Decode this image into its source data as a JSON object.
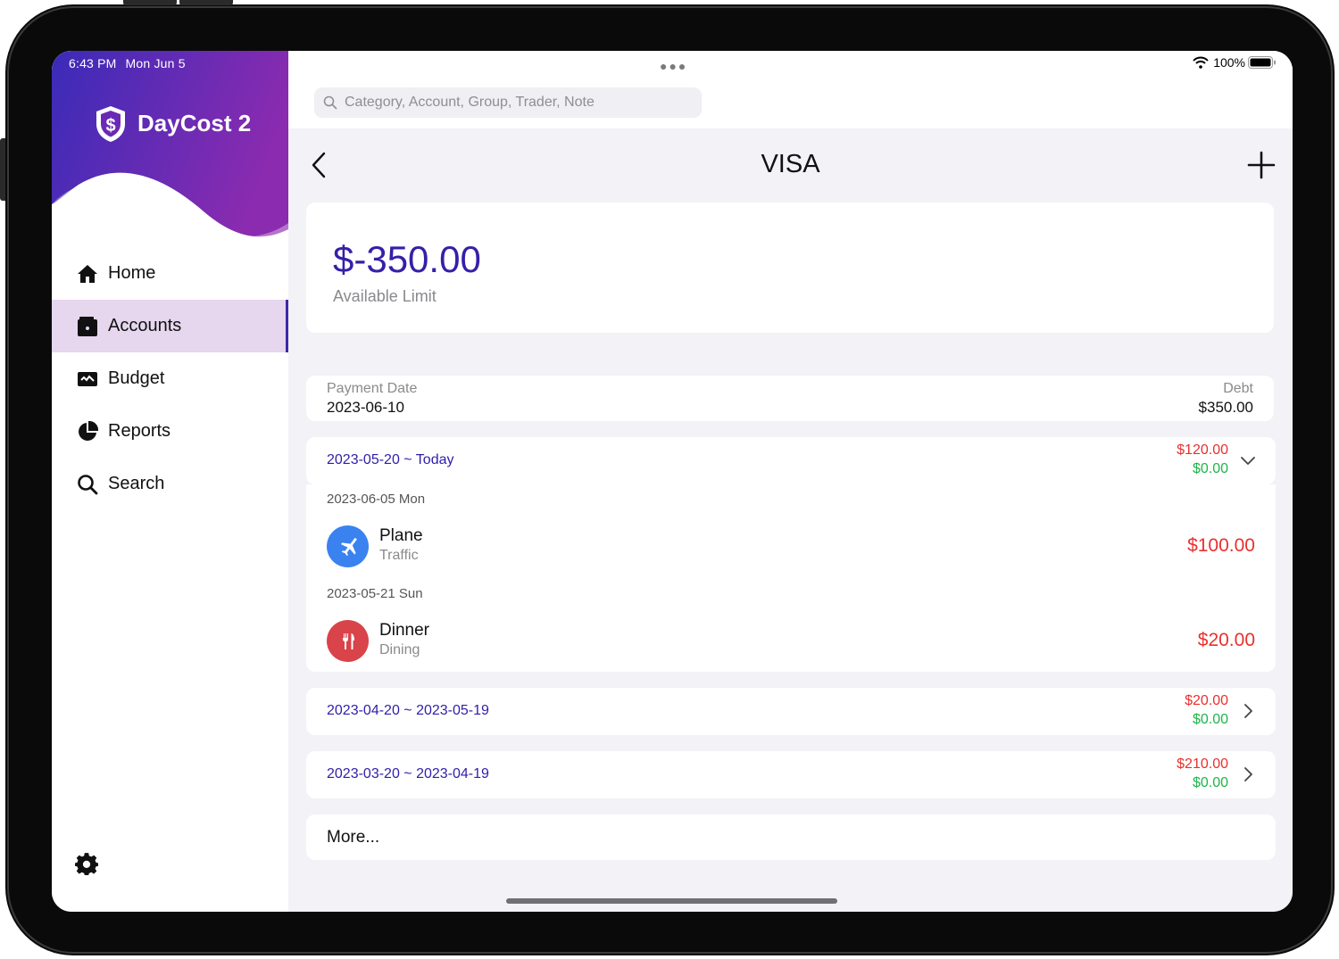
{
  "status": {
    "time": "6:43 PM",
    "date": "Mon Jun 5",
    "battery": "100%"
  },
  "app": {
    "title": "DayCost 2"
  },
  "sidebar": {
    "items": [
      {
        "label": "Home",
        "icon": "home-icon"
      },
      {
        "label": "Accounts",
        "icon": "wallet-icon"
      },
      {
        "label": "Budget",
        "icon": "budget-icon"
      },
      {
        "label": "Reports",
        "icon": "pie-chart-icon"
      },
      {
        "label": "Search",
        "icon": "search-icon"
      }
    ],
    "active_index": 1
  },
  "search": {
    "placeholder": "Category, Account, Group, Trader, Note"
  },
  "header": {
    "title": "VISA"
  },
  "summary": {
    "amount": "$-350.00",
    "label": "Available Limit"
  },
  "payment": {
    "date_label": "Payment Date",
    "date": "2023-06-10",
    "debt_label": "Debt",
    "debt": "$350.00"
  },
  "periods": [
    {
      "range": "2023-05-20 ~ Today",
      "expense": "$120.00",
      "income": "$0.00",
      "expanded": true,
      "groups": [
        {
          "date": "2023-06-05 Mon",
          "transactions": [
            {
              "name": "Plane",
              "category": "Traffic",
              "amount": "$100.00",
              "icon": "airplane-icon",
              "color": "#3a82f0"
            }
          ]
        },
        {
          "date": "2023-05-21 Sun",
          "transactions": [
            {
              "name": "Dinner",
              "category": "Dining",
              "amount": "$20.00",
              "icon": "fork-knife-icon",
              "color": "#d9434a"
            }
          ]
        }
      ]
    },
    {
      "range": "2023-04-20 ~ 2023-05-19",
      "expense": "$20.00",
      "income": "$0.00",
      "expanded": false
    },
    {
      "range": "2023-03-20 ~ 2023-04-19",
      "expense": "$210.00",
      "income": "$0.00",
      "expanded": false
    }
  ],
  "more_label": "More...",
  "colors": {
    "accent": "#3520a8",
    "sidebar_gradient_start": "#3a2bb8",
    "sidebar_gradient_end": "#8a2bb0",
    "expense": "#e8312e",
    "income": "#1fb54a",
    "active_nav": "#e6d6ee"
  }
}
